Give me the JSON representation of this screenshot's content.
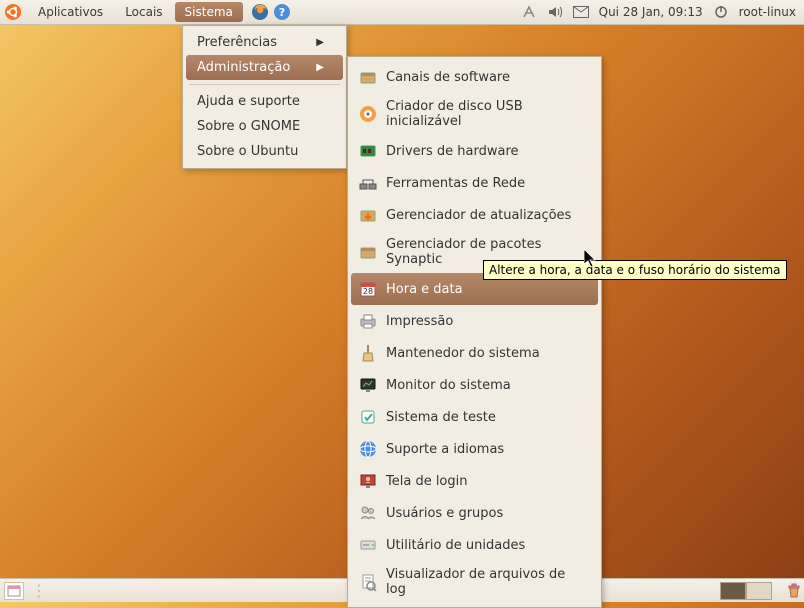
{
  "panel": {
    "menus": [
      "Aplicativos",
      "Locais",
      "Sistema"
    ],
    "active_menu": "Sistema",
    "datetime": "Qui 28 Jan, 09:13",
    "user": "root-linux"
  },
  "system_menu": {
    "items": [
      {
        "label": "Preferências",
        "has_submenu": true
      },
      {
        "label": "Administração",
        "has_submenu": true,
        "highlight": true
      }
    ],
    "items2": [
      {
        "label": "Ajuda e suporte"
      },
      {
        "label": "Sobre o GNOME"
      },
      {
        "label": "Sobre o Ubuntu"
      }
    ]
  },
  "admin_menu": [
    {
      "icon": "channels",
      "label": "Canais de software"
    },
    {
      "icon": "usb",
      "label": "Criador de disco USB inicializável"
    },
    {
      "icon": "drivers",
      "label": "Drivers de hardware"
    },
    {
      "icon": "network",
      "label": "Ferramentas de Rede"
    },
    {
      "icon": "updates",
      "label": "Gerenciador de atualizações"
    },
    {
      "icon": "synaptic",
      "label": "Gerenciador de pacotes Synaptic"
    },
    {
      "icon": "datetime",
      "label": "Hora e data",
      "highlight": true
    },
    {
      "icon": "printer",
      "label": "Impressão"
    },
    {
      "icon": "janitor",
      "label": "Mantenedor do sistema"
    },
    {
      "icon": "monitor",
      "label": "Monitor do sistema"
    },
    {
      "icon": "test",
      "label": "Sistema de teste"
    },
    {
      "icon": "language",
      "label": "Suporte a idiomas"
    },
    {
      "icon": "login",
      "label": "Tela de login"
    },
    {
      "icon": "users",
      "label": "Usuários e grupos"
    },
    {
      "icon": "disk",
      "label": "Utilitário de unidades"
    },
    {
      "icon": "log",
      "label": "Visualizador de arquivos de log"
    }
  ],
  "tooltip": "Altere a hora, a data e o fuso horário do sistema"
}
